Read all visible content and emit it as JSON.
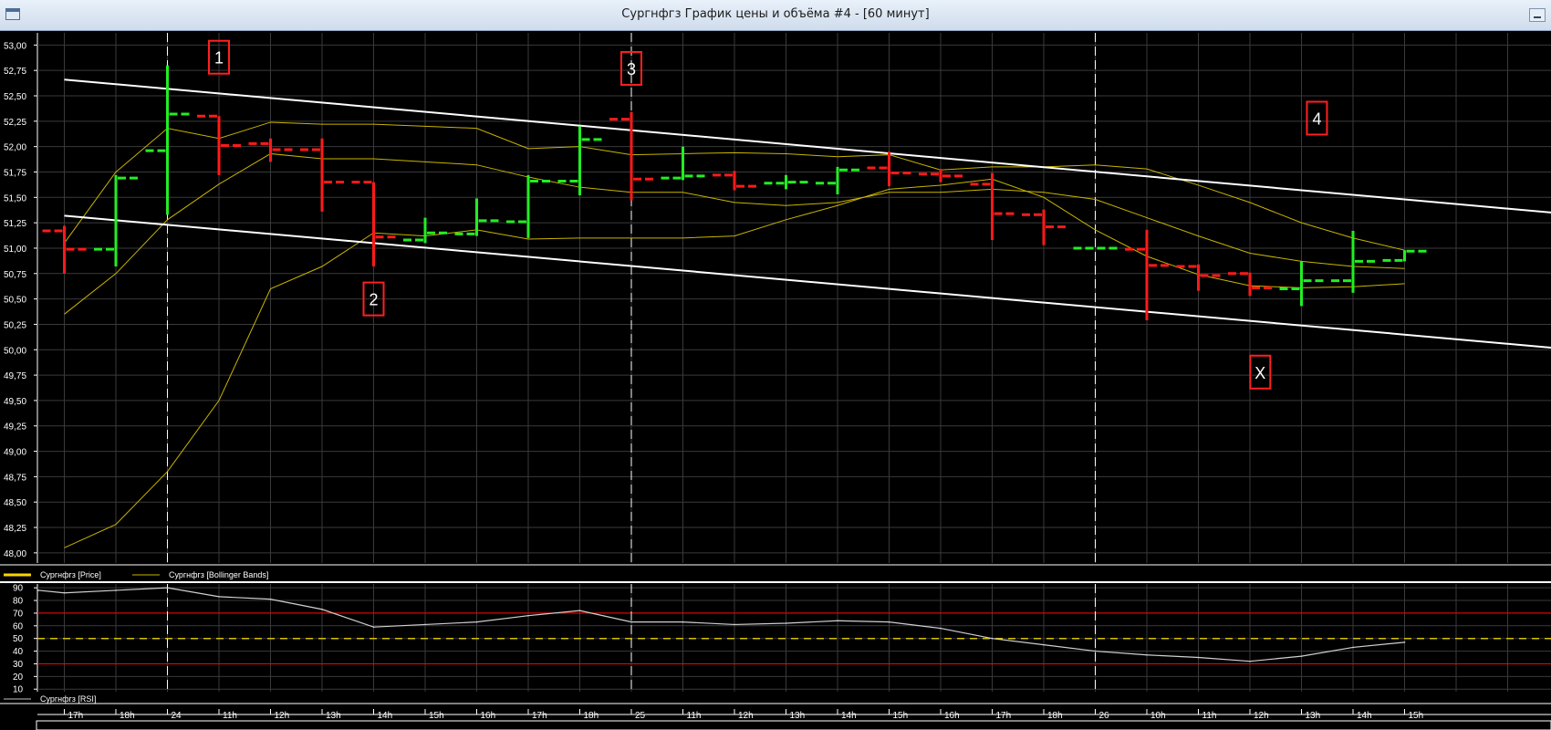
{
  "window": {
    "title": "Сургнфгз График цены и объёма #4 - [60 минут]"
  },
  "colors": {
    "bull": "#22ee22",
    "bear": "#ff1a1a",
    "bands": "#c8b400",
    "trend": "#ffffff",
    "rsi_line": "#d0d0d0",
    "rsi_mid": "#d4c200",
    "rsi_bounds": "#ff0000",
    "grid": "#3a3a3a"
  },
  "legend": {
    "price": "Сургнфгз [Price]",
    "bands": "Сургнфгз [Bollinger Bands]",
    "rsi": "Сургнфгз [RSI]"
  },
  "annotations": [
    {
      "label": "1",
      "slot": 3,
      "price": 52.88
    },
    {
      "label": "2",
      "slot": 6,
      "price": 50.5
    },
    {
      "label": "3",
      "slot": 11,
      "price": 52.77
    },
    {
      "label": "4",
      "slot": 24.3,
      "price": 52.28
    },
    {
      "label": "X",
      "slot": 23.2,
      "price": 49.78
    }
  ],
  "chart_data": [
    {
      "type": "ohlc",
      "y_ticks": [
        "53,00",
        "52,75",
        "52,50",
        "52,25",
        "52,00",
        "51,75",
        "51,50",
        "51,25",
        "51,00",
        "50,75",
        "50,50",
        "50,25",
        "50,00",
        "49,75",
        "49,50",
        "49,25",
        "49,00",
        "48,75",
        "48,50",
        "48,25",
        "48,00"
      ],
      "ylim": [
        47.9,
        53.12
      ],
      "x_labels": [
        "17h",
        "18h",
        "24",
        "11h",
        "12h",
        "13h",
        "14h",
        "15h",
        "16h",
        "17h",
        "18h",
        "25",
        "11h",
        "12h",
        "13h",
        "14h",
        "15h",
        "16h",
        "17h",
        "18h",
        "26",
        "10h",
        "11h",
        "12h",
        "13h",
        "14h",
        "15h"
      ],
      "day_separators": [
        2,
        11,
        20
      ],
      "bars": [
        {
          "o": 51.17,
          "h": 51.22,
          "l": 50.75,
          "c": 50.99
        },
        {
          "o": 50.99,
          "h": 51.72,
          "l": 50.82,
          "c": 51.69
        },
        {
          "o": 51.96,
          "h": 52.8,
          "l": 51.33,
          "c": 52.32
        },
        {
          "o": 52.3,
          "h": 52.3,
          "l": 51.72,
          "c": 52.01
        },
        {
          "o": 52.03,
          "h": 52.08,
          "l": 51.85,
          "c": 51.97
        },
        {
          "o": 51.97,
          "h": 52.08,
          "l": 51.36,
          "c": 51.65
        },
        {
          "o": 51.65,
          "h": 51.65,
          "l": 50.82,
          "c": 51.11
        },
        {
          "o": 51.08,
          "h": 51.3,
          "l": 51.05,
          "c": 51.15
        },
        {
          "o": 51.14,
          "h": 51.49,
          "l": 51.12,
          "c": 51.27
        },
        {
          "o": 51.26,
          "h": 51.72,
          "l": 51.1,
          "c": 51.66
        },
        {
          "o": 51.66,
          "h": 52.2,
          "l": 51.52,
          "c": 52.07
        },
        {
          "o": 52.27,
          "h": 52.34,
          "l": 51.47,
          "c": 51.68
        },
        {
          "o": 51.69,
          "h": 52.0,
          "l": 51.67,
          "c": 51.71
        },
        {
          "o": 51.72,
          "h": 51.76,
          "l": 51.57,
          "c": 51.61
        },
        {
          "o": 51.64,
          "h": 51.72,
          "l": 51.58,
          "c": 51.65
        },
        {
          "o": 51.64,
          "h": 51.8,
          "l": 51.53,
          "c": 51.77
        },
        {
          "o": 51.79,
          "h": 51.95,
          "l": 51.61,
          "c": 51.74
        },
        {
          "o": 51.73,
          "h": 51.78,
          "l": 51.65,
          "c": 51.71
        },
        {
          "o": 51.63,
          "h": 51.74,
          "l": 51.08,
          "c": 51.34
        },
        {
          "o": 51.33,
          "h": 51.38,
          "l": 51.03,
          "c": 51.21
        },
        {
          "o": 51.0,
          "h": 51.0,
          "l": 51.0,
          "c": 51.0
        },
        {
          "o": 50.99,
          "h": 51.18,
          "l": 50.29,
          "c": 50.83
        },
        {
          "o": 50.82,
          "h": 50.84,
          "l": 50.58,
          "c": 50.73
        },
        {
          "o": 50.75,
          "h": 50.76,
          "l": 50.53,
          "c": 50.61
        },
        {
          "o": 50.6,
          "h": 50.87,
          "l": 50.43,
          "c": 50.68
        },
        {
          "o": 50.68,
          "h": 51.17,
          "l": 50.56,
          "c": 50.87
        },
        {
          "o": 50.88,
          "h": 50.98,
          "l": 50.87,
          "c": 50.97
        }
      ],
      "bollinger": {
        "upper": [
          51.05,
          51.75,
          52.18,
          52.08,
          52.24,
          52.22,
          52.22,
          52.2,
          52.18,
          51.98,
          52.0,
          51.92,
          51.93,
          51.94,
          51.93,
          51.9,
          51.92,
          51.77,
          51.8,
          51.8,
          51.82,
          51.78,
          51.62,
          51.45,
          51.25,
          51.1,
          50.98
        ],
        "middle": [
          50.35,
          50.75,
          51.28,
          51.63,
          51.93,
          51.88,
          51.88,
          51.85,
          51.82,
          51.7,
          51.6,
          51.55,
          51.55,
          51.45,
          51.42,
          51.45,
          51.55,
          51.55,
          51.58,
          51.55,
          51.48,
          51.3,
          51.12,
          50.95,
          50.87,
          50.82,
          50.8
        ],
        "lower": [
          48.05,
          48.28,
          48.8,
          49.5,
          50.6,
          50.82,
          51.15,
          51.12,
          51.18,
          51.09,
          51.1,
          51.1,
          51.1,
          51.12,
          51.28,
          51.42,
          51.58,
          51.62,
          51.68,
          51.5,
          51.18,
          50.92,
          50.74,
          50.63,
          50.61,
          50.62,
          50.65
        ],
        "slots": [
          0,
          1,
          2,
          3,
          4,
          5,
          6,
          7,
          8,
          9,
          10,
          11,
          12,
          13,
          14,
          15,
          16,
          17,
          18,
          19,
          20,
          21,
          22,
          23,
          24,
          25,
          26
        ],
        "lower_slots_note": "lower band values listed per slot"
      },
      "trendlines": [
        {
          "from": [
            0,
            52.66
          ],
          "to": [
            29.3,
            51.33
          ]
        },
        {
          "from": [
            0,
            51.32
          ],
          "to": [
            29.3,
            50.0
          ]
        }
      ]
    },
    {
      "type": "line",
      "name": "RSI",
      "y_ticks": [
        "90",
        "80",
        "70",
        "60",
        "50",
        "40",
        "30",
        "20",
        "10"
      ],
      "ylim": [
        8,
        93
      ],
      "levels": [
        70,
        50,
        30
      ],
      "x": [
        -0.5,
        0,
        1,
        2,
        3,
        4,
        5,
        6,
        7,
        8,
        9,
        10,
        11,
        12,
        13,
        14,
        15,
        16,
        17,
        18,
        19,
        20,
        21,
        22,
        23,
        24,
        25,
        26
      ],
      "values": [
        88,
        86,
        88,
        90,
        83,
        81,
        73,
        59,
        61,
        63,
        68,
        72,
        63,
        63,
        61,
        62,
        64,
        63,
        58,
        50,
        45,
        40,
        37,
        35,
        32,
        36,
        43,
        47
      ]
    }
  ]
}
